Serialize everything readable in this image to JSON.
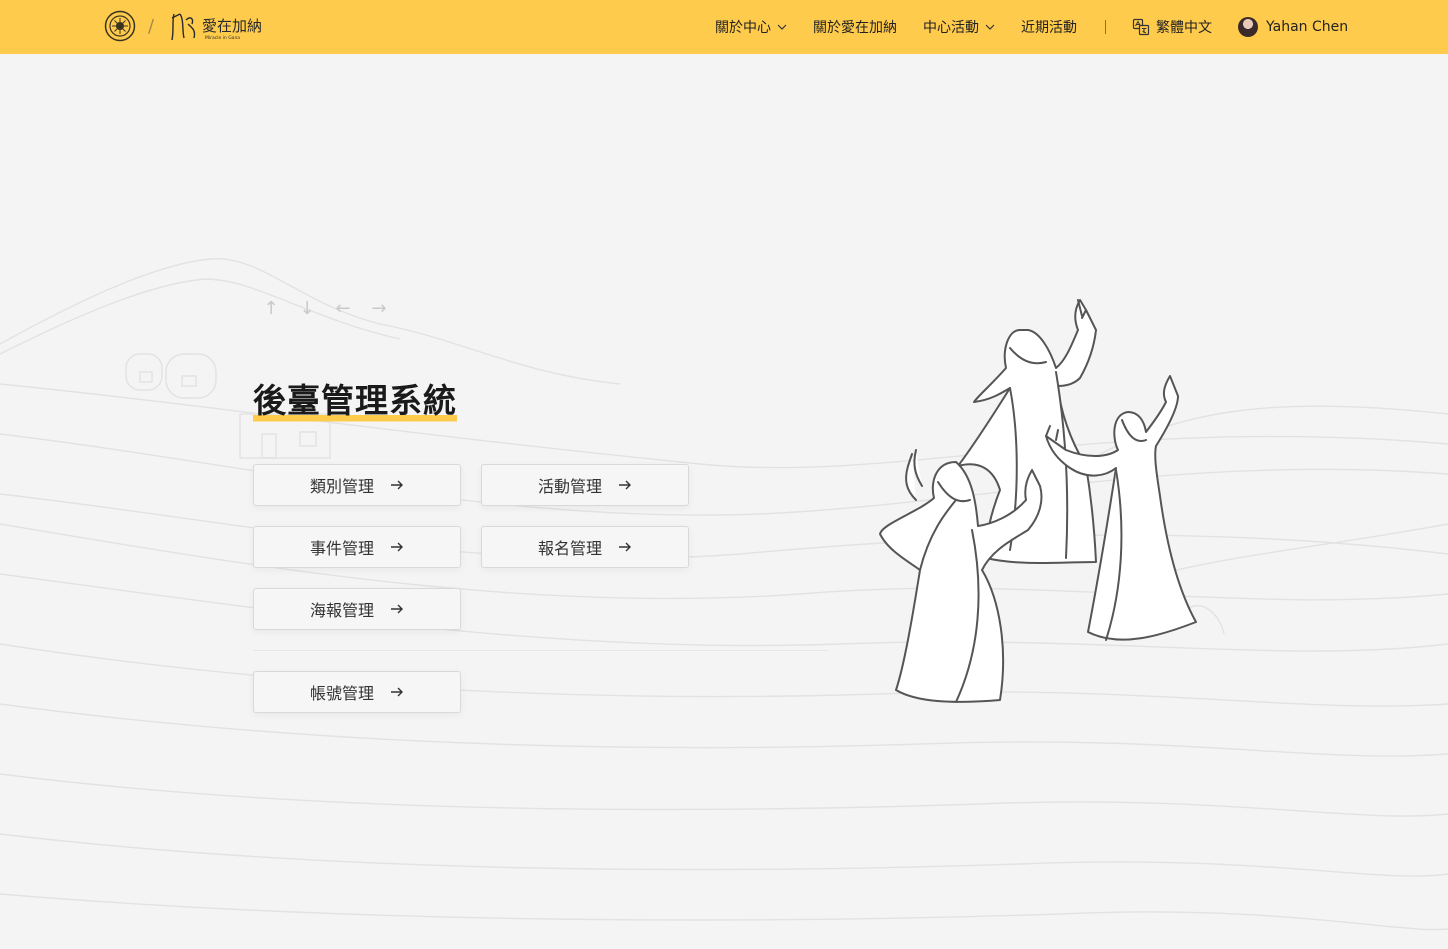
{
  "header": {
    "brand": {
      "seal_icon": "temple-seal-icon",
      "logo_icon": "love-in-ghana-logo",
      "logo_text": "愛在加納",
      "logo_subtext": "Miracle in Gana",
      "separator": "/"
    },
    "nav": [
      {
        "label": "關於中心",
        "has_dropdown": true
      },
      {
        "label": "關於愛在加納",
        "has_dropdown": false
      },
      {
        "label": "中心活動",
        "has_dropdown": true
      },
      {
        "label": "近期活動",
        "has_dropdown": false
      }
    ],
    "language": {
      "label": "繁體中文",
      "icon": "translate-icon"
    },
    "user": {
      "name": "Yahan Chen",
      "icon": "avatar"
    },
    "colors": {
      "bar": "#ffcb4c"
    }
  },
  "main": {
    "arrows": [
      "↑",
      "↓",
      "←",
      "→"
    ],
    "title": "後臺管理系統",
    "cards": [
      {
        "label": "類別管理"
      },
      {
        "label": "活動管理"
      },
      {
        "label": "事件管理"
      },
      {
        "label": "報名管理"
      },
      {
        "label": "海報管理"
      },
      {
        "label": "帳號管理"
      }
    ],
    "accent": "#ffcb4c"
  }
}
